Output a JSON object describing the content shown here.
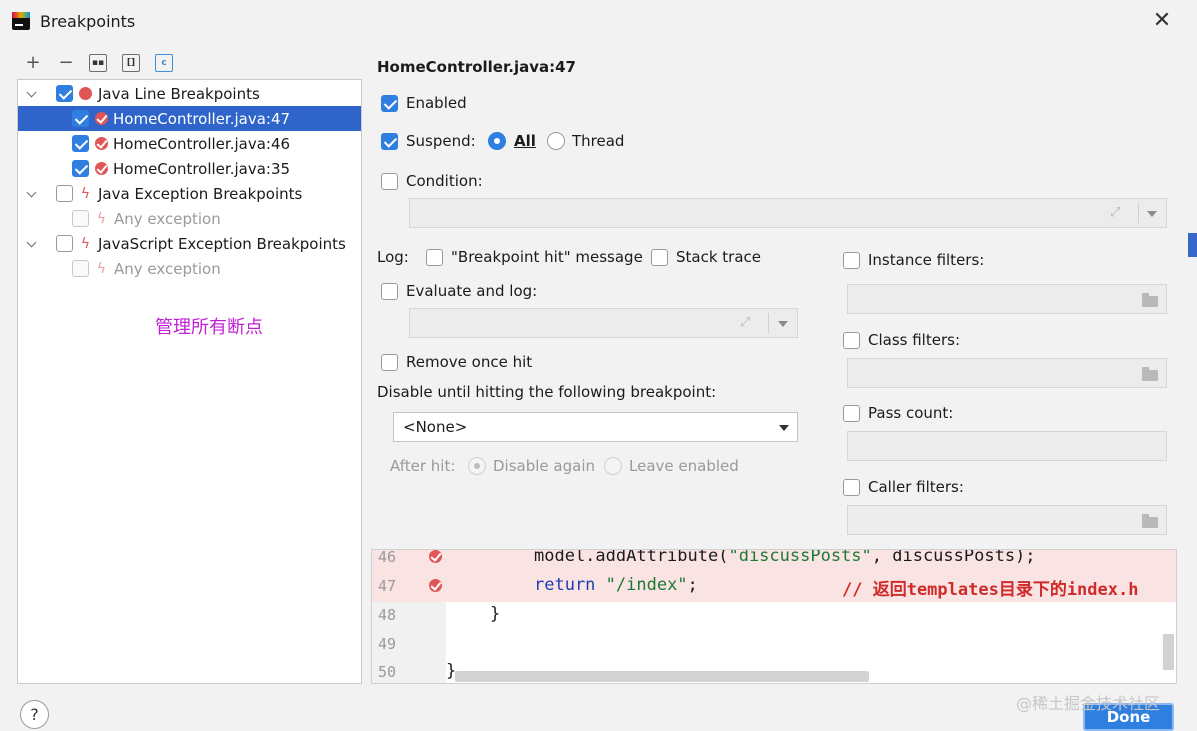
{
  "window": {
    "title": "Breakpoints",
    "close_glyph": "✕"
  },
  "toolbar": {
    "add": "+",
    "remove": "−",
    "btn1": "▪▪",
    "btn2": "[]",
    "btn3": "c"
  },
  "tree": {
    "groups": [
      {
        "label": "Java Line Breakpoints",
        "checked": true,
        "items": [
          {
            "label": "HomeController.java:47",
            "checked": true,
            "selected": true
          },
          {
            "label": "HomeController.java:46",
            "checked": true
          },
          {
            "label": "HomeController.java:35",
            "checked": true
          }
        ]
      },
      {
        "label": "Java Exception Breakpoints",
        "checked": false,
        "items": [
          {
            "label": "Any exception",
            "checked": false,
            "disabled": true
          }
        ]
      },
      {
        "label": "JavaScript Exception Breakpoints",
        "checked": false,
        "items": [
          {
            "label": "Any exception",
            "checked": false,
            "disabled": true
          }
        ]
      }
    ],
    "note": "管理所有断点"
  },
  "detail": {
    "header": "HomeController.java:47",
    "enabled_label": "Enabled",
    "suspend_label": "Suspend:",
    "suspend_all": "All",
    "suspend_thread": "Thread",
    "condition_label": "Condition:",
    "log_label": "Log:",
    "log_message": "\"Breakpoint hit\" message",
    "log_stack": "Stack trace",
    "evaluate_label": "Evaluate and log:",
    "remove_once": "Remove once hit",
    "disable_until": "Disable until hitting the following breakpoint:",
    "select_value": "<None>",
    "after_hit": "After hit:",
    "disable_again": "Disable again",
    "leave_enabled": "Leave enabled",
    "instance_filters": "Instance filters:",
    "class_filters": "Class filters:",
    "pass_count": "Pass count:",
    "caller_filters": "Caller filters:"
  },
  "code": {
    "lines": [
      {
        "num": "46",
        "a": "model.addAttribute(",
        "b": "\"discussPosts\"",
        "c": ", discussPosts);"
      },
      {
        "num": "47",
        "kw": "return ",
        "s": "\"/index\"",
        "rest": ";",
        "comment": "// 返回templates目录下的index.h"
      },
      {
        "num": "48",
        "text": "}"
      },
      {
        "num": "49",
        "text": ""
      },
      {
        "num": "50",
        "text": "}"
      }
    ]
  },
  "footer": {
    "help": "?",
    "done": "Done",
    "watermark": "@稀土掘金技术社区"
  }
}
